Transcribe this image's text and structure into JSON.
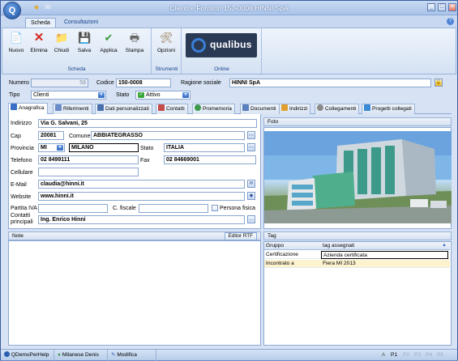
{
  "window": {
    "title": "Clienti e Fornitori 150-0008 HINNI SpA",
    "app_badge": "Q",
    "controls": {
      "minimize": "_",
      "maximize": "□",
      "close": "×"
    }
  },
  "ribbon": {
    "tabs": [
      {
        "label": "Scheda",
        "active": true
      },
      {
        "label": "Consultazioni",
        "active": false
      }
    ],
    "help": "?",
    "groups": {
      "scheda": {
        "label": "Scheda",
        "buttons": [
          {
            "label": "Nuovo",
            "icon": "new-document-icon"
          },
          {
            "label": "Elimina",
            "icon": "delete-x-icon"
          },
          {
            "label": "Chiudi",
            "icon": "close-folder-icon"
          },
          {
            "label": "Salva",
            "icon": "save-disk-icon"
          },
          {
            "label": "Applica",
            "icon": "apply-icon"
          },
          {
            "label": "Stampa",
            "icon": "printer-icon"
          }
        ]
      },
      "strumenti": {
        "label": "Strumenti",
        "buttons": [
          {
            "label": "Opzioni",
            "icon": "options-tools-icon"
          }
        ]
      },
      "online": {
        "label": "Online",
        "logo_text": "qualibus"
      }
    }
  },
  "header": {
    "numero_label": "Numero",
    "numero_value": "58",
    "codice_label": "Codice",
    "codice_value": "150-0008",
    "ragione_label": "Ragione sociale",
    "ragione_value": "HINNI SpA",
    "tipo_label": "Tipo",
    "tipo_value": "Clienti",
    "stato_label": "Stato",
    "stato_value": "Attivo"
  },
  "tabs": [
    {
      "label": "Anagrafica",
      "active": true,
      "color": "#3a6fc7"
    },
    {
      "label": "Riferimenti",
      "active": false,
      "color": "#6b8cc9"
    },
    {
      "label": "Dati personalizzati",
      "active": false,
      "color": "#4a6fae"
    },
    {
      "label": "Contatti",
      "active": false,
      "color": "#c74a4a"
    },
    {
      "label": "Promemoria",
      "active": false,
      "color": "#3d9a4c"
    },
    {
      "label": "Documenti",
      "active": false,
      "color": "#5b7fbf"
    },
    {
      "label": "Indirizzi",
      "active": false,
      "color": "#e0a030"
    },
    {
      "label": "Collegamenti",
      "active": false,
      "color": "#8a8a8a"
    },
    {
      "label": "Progetti collegati",
      "active": false,
      "color": "#3a8ad6"
    }
  ],
  "anagrafica": {
    "indirizzo_label": "Indirizzo",
    "indirizzo_value": "Via G. Salvani, 25",
    "cap_label": "Cap",
    "cap_value": "20081",
    "comune_label": "Comune",
    "comune_value": "ABBIATEGRASSO",
    "provincia_label": "Provincia",
    "provincia_value": "MI",
    "provincia_name": "MILANO",
    "stato_label": "Stato",
    "stato_value": "ITALIA",
    "telefono_label": "Telefono",
    "telefono_value": "02 8499111",
    "fax_label": "Fax",
    "fax_value": "02 84669001",
    "cellulare_label": "Cellulare",
    "cellulare_value": "",
    "email_label": "E-Mail",
    "email_value": "claudia@hinni.it",
    "website_label": "Website",
    "website_value": "www.hinni.it",
    "piva_label": "Partita IVA",
    "piva_value": "",
    "cf_label": "C. fiscale",
    "cf_value": "",
    "persona_fisica_label": "Persona fisica",
    "contatti_label": "Contatti\nprincipali",
    "contatti_value": "Ing. Enrico Hinni"
  },
  "foto": {
    "label": "Foto"
  },
  "note": {
    "label": "Note",
    "rtf_button": "Editor RTF"
  },
  "tag": {
    "label": "Tag",
    "columns": [
      "Gruppo",
      "tag assegnati"
    ],
    "rows": [
      {
        "gruppo": "Certificazione",
        "tag": "Azienda certificata"
      },
      {
        "gruppo": "Incontrato a",
        "tag": "Fiera MI 2013"
      }
    ]
  },
  "statusbar": {
    "app": "QDemoPerHelp",
    "user": "Milanese Denis",
    "mode": "Modifica",
    "pages": [
      "A",
      "P1",
      "P2",
      "P3",
      "P4",
      "P5"
    ]
  }
}
